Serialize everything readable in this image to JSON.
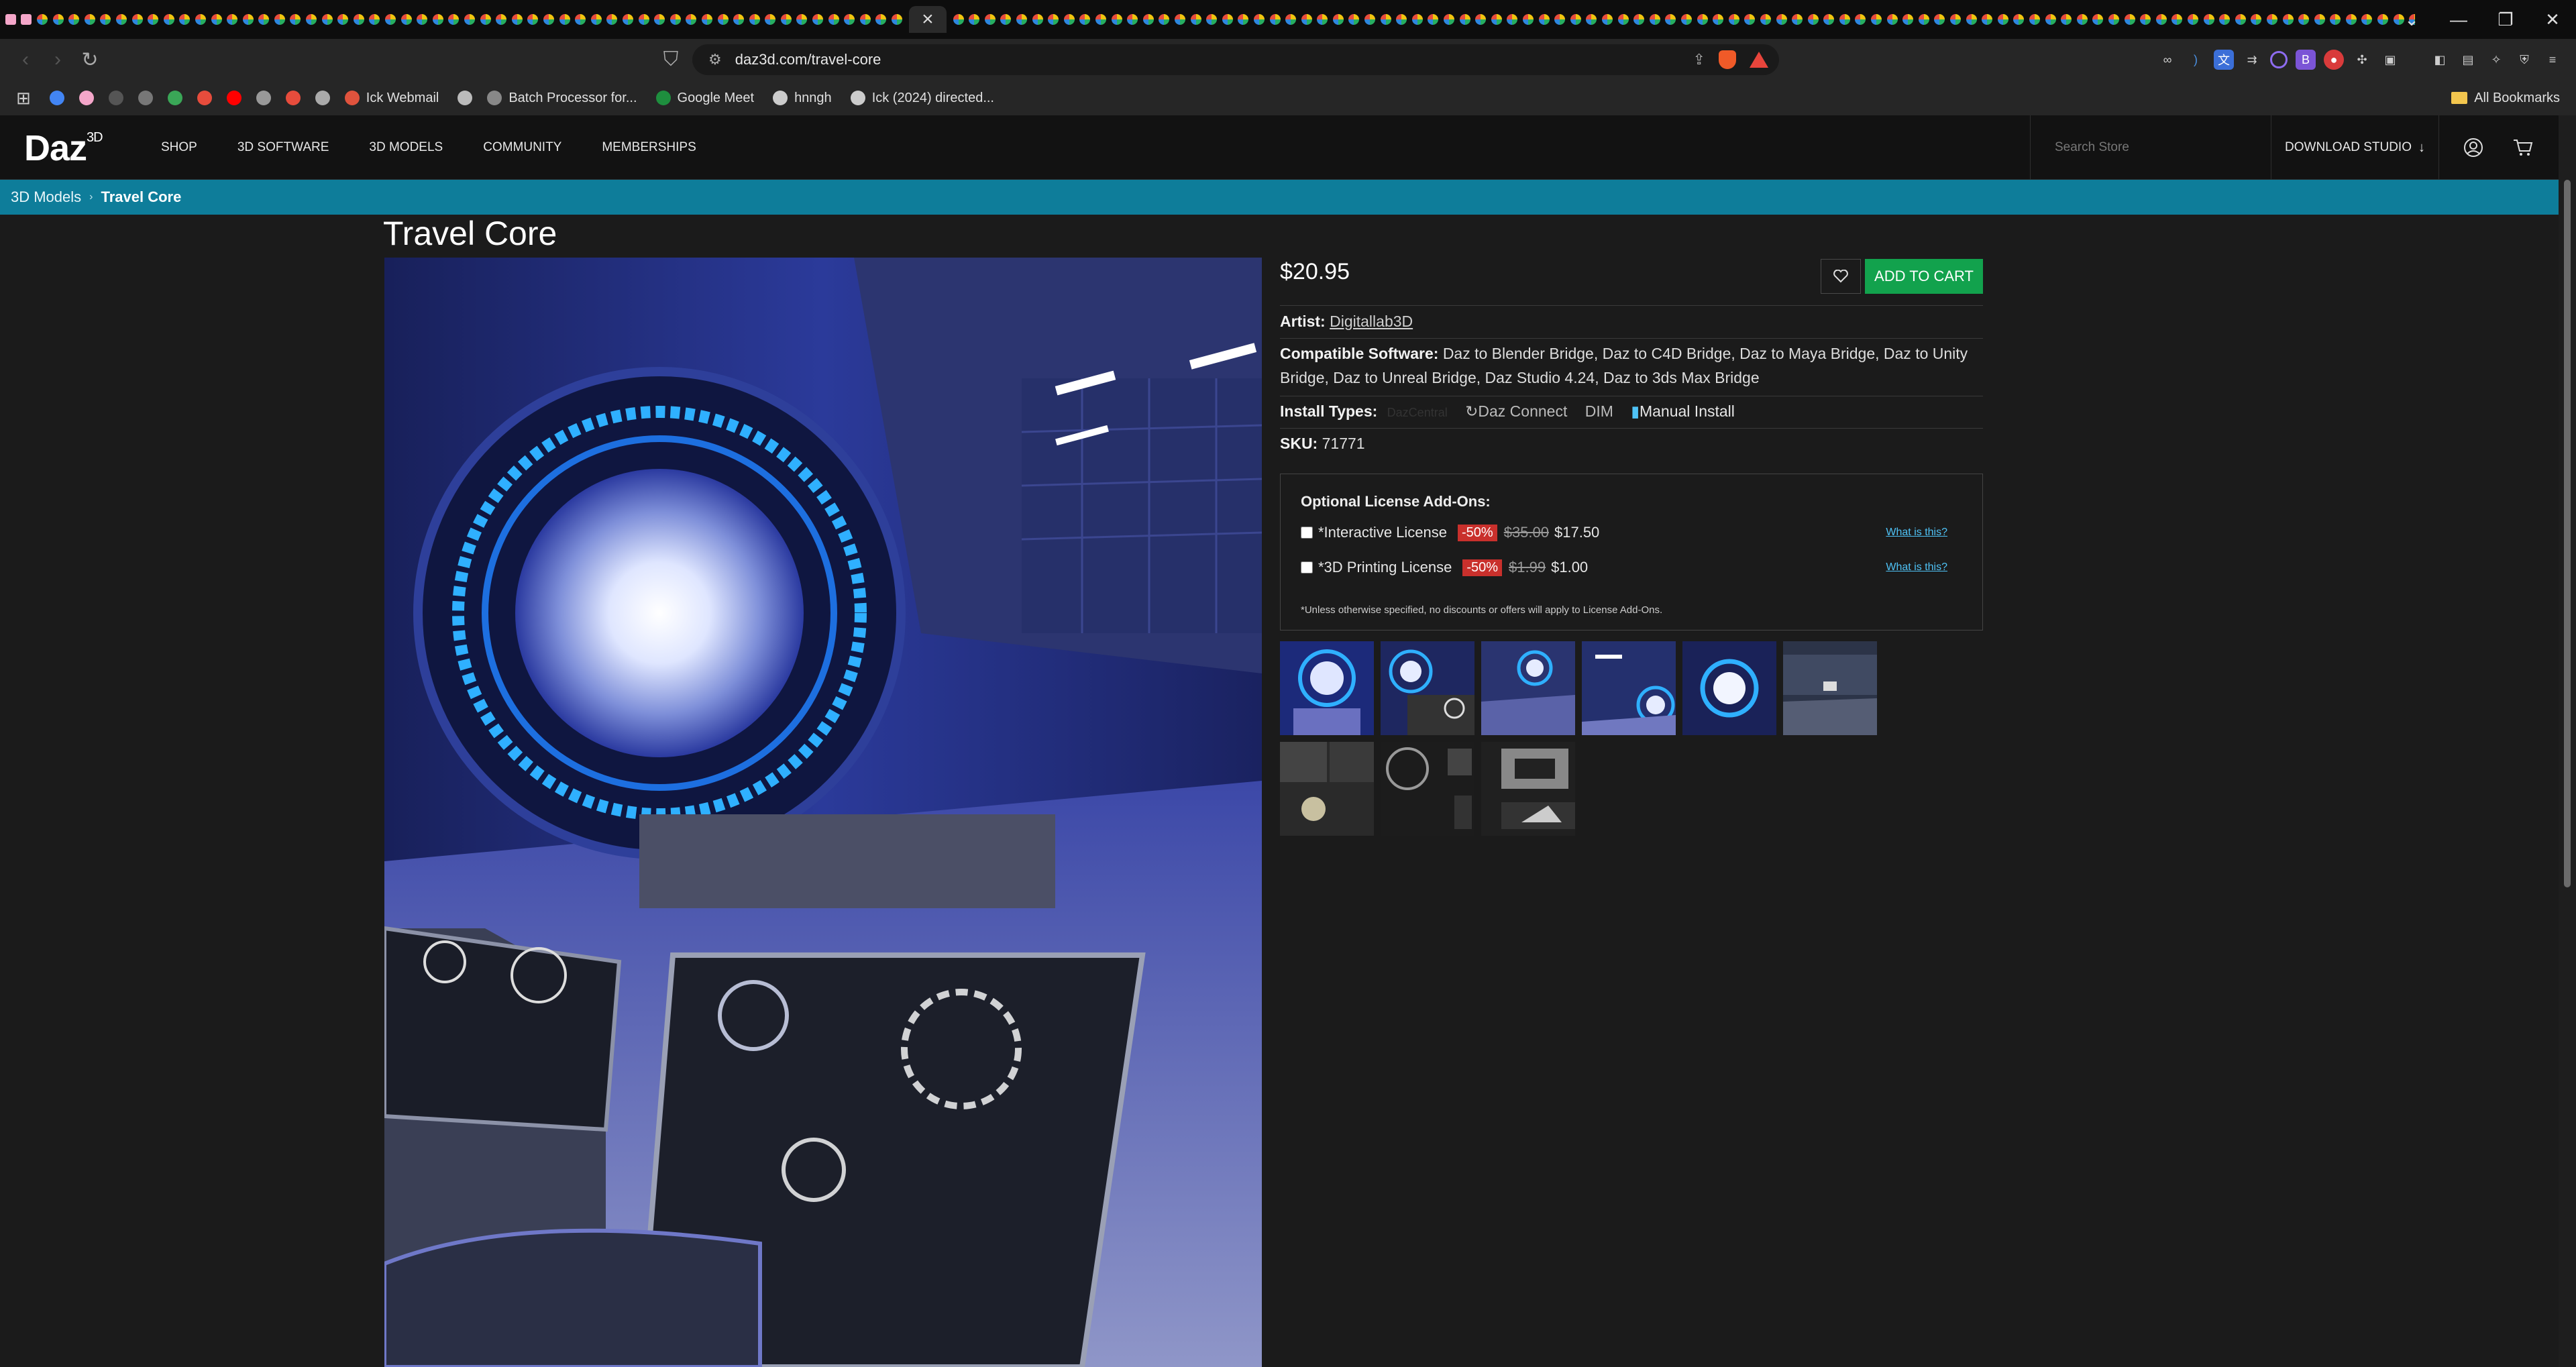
{
  "browser": {
    "tab_count_pinned": 1,
    "active_tab_close": "×",
    "new_tab": "+",
    "url": "daz3d.com/travel-core",
    "bookmarks": [
      {
        "label": ""
      },
      {
        "label": ""
      },
      {
        "label": ""
      },
      {
        "label": ""
      },
      {
        "label": ""
      },
      {
        "label": ""
      },
      {
        "label": ""
      },
      {
        "label": ""
      },
      {
        "label": ""
      },
      {
        "label": ""
      },
      {
        "label": "Ick Webmail"
      },
      {
        "label": ""
      },
      {
        "label": "Batch Processor for..."
      },
      {
        "label": "Google Meet"
      },
      {
        "label": "hnngh"
      },
      {
        "label": "Ick (2024) directed..."
      }
    ],
    "all_bookmarks": "All Bookmarks"
  },
  "site": {
    "logo": "Daz",
    "logo_sup": "3D",
    "nav": [
      "SHOP",
      "3D SOFTWARE",
      "3D MODELS",
      "COMMUNITY",
      "MEMBERSHIPS"
    ],
    "search_placeholder": "Search Store",
    "download_studio": "DOWNLOAD STUDIO"
  },
  "breadcrumb": {
    "parent": "3D Models",
    "separator": "›",
    "current": "Travel Core"
  },
  "product": {
    "title": "Travel Core",
    "price": "$20.95",
    "add_to_cart": "ADD TO CART",
    "artist_label": "Artist:",
    "artist": "Digitallab3D",
    "compat_label": "Compatible Software:",
    "compat": "Daz to Blender Bridge, Daz to C4D Bridge, Daz to Maya Bridge, Daz to Unity Bridge, Daz to Unreal Bridge, Daz Studio 4.24, Daz to 3ds Max Bridge",
    "install_label": "Install Types:",
    "install_types": [
      "DazCentral",
      "Daz Connect",
      "DIM",
      "Manual Install"
    ],
    "sku_label": "SKU:",
    "sku": "71771"
  },
  "license": {
    "title": "Optional License Add-Ons:",
    "items": [
      {
        "name": "*Interactive License",
        "discount": "-50%",
        "old_price": "$35.00",
        "new_price": "$17.50",
        "help": "What is this?"
      },
      {
        "name": "*3D Printing License",
        "discount": "-50%",
        "old_price": "$1.99",
        "new_price": "$1.00",
        "help": "What is this?"
      }
    ],
    "note": "*Unless otherwise specified, no discounts or offers will apply to License Add-Ons."
  },
  "colors": {
    "accent_bar": "#0e7d9a",
    "cart_green": "#12a24d",
    "discount_red": "#c9302c",
    "link_blue": "#4fc3f7"
  }
}
